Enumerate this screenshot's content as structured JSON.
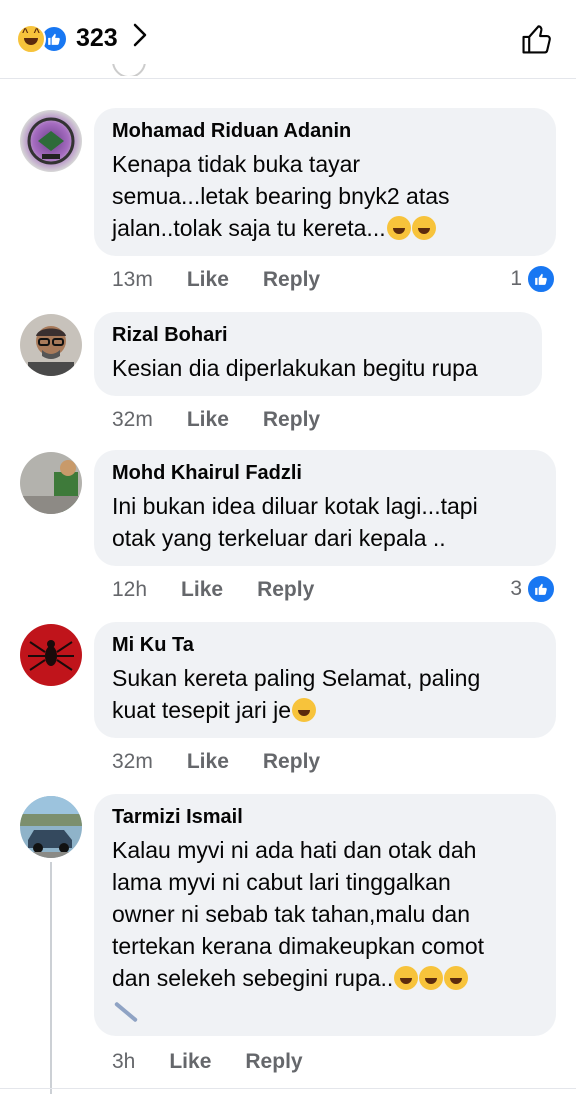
{
  "header": {
    "reaction_count": "323",
    "reactions": [
      "haha-icon",
      "like-icon"
    ]
  },
  "comments": [
    {
      "name": "Mohamad Riduan Adanin",
      "text": "Kenapa tidak buka tayar\nsemua...letak bearing bnyk2 atas\njalan..tolak saja tu kereta...",
      "emojis": [
        "rolling-laugh-icon",
        "rolling-laugh-icon"
      ],
      "time": "13m",
      "like": "Like",
      "reply": "Reply",
      "reaction_count": "1"
    },
    {
      "name": "Rizal Bohari",
      "text": "Kesian dia diperlakukan begitu rupa",
      "time": "32m",
      "like": "Like",
      "reply": "Reply"
    },
    {
      "name": "Mohd Khairul Fadzli",
      "text": "Ini bukan idea diluar kotak lagi...tapi\notak yang terkeluar dari kepala ..",
      "time": "12h",
      "like": "Like",
      "reply": "Reply",
      "reaction_count": "3"
    },
    {
      "name": "Mi Ku Ta",
      "text": "Sukan kereta paling Selamat, paling\nkuat tesepit jari je",
      "emojis": [
        "relieved-face-icon"
      ],
      "time": "32m",
      "like": "Like",
      "reply": "Reply"
    },
    {
      "name": "Tarmizi Ismail",
      "text": "Kalau myvi ni ada hati dan otak dah\nlama myvi ni cabut lari tinggalkan\nowner ni sebab tak tahan,malu dan\ntertekan kerana dimakeupkan comot\ndan selekeh sebegini rupa..",
      "emojis": [
        "grin-icon",
        "smile-icon",
        "thinking-face-icon"
      ],
      "time": "3h",
      "like": "Like",
      "reply": "Reply"
    }
  ],
  "colors": {
    "like_blue": "#1877f2",
    "bubble_bg": "#f0f2f5",
    "meta_gray": "#65676b"
  }
}
